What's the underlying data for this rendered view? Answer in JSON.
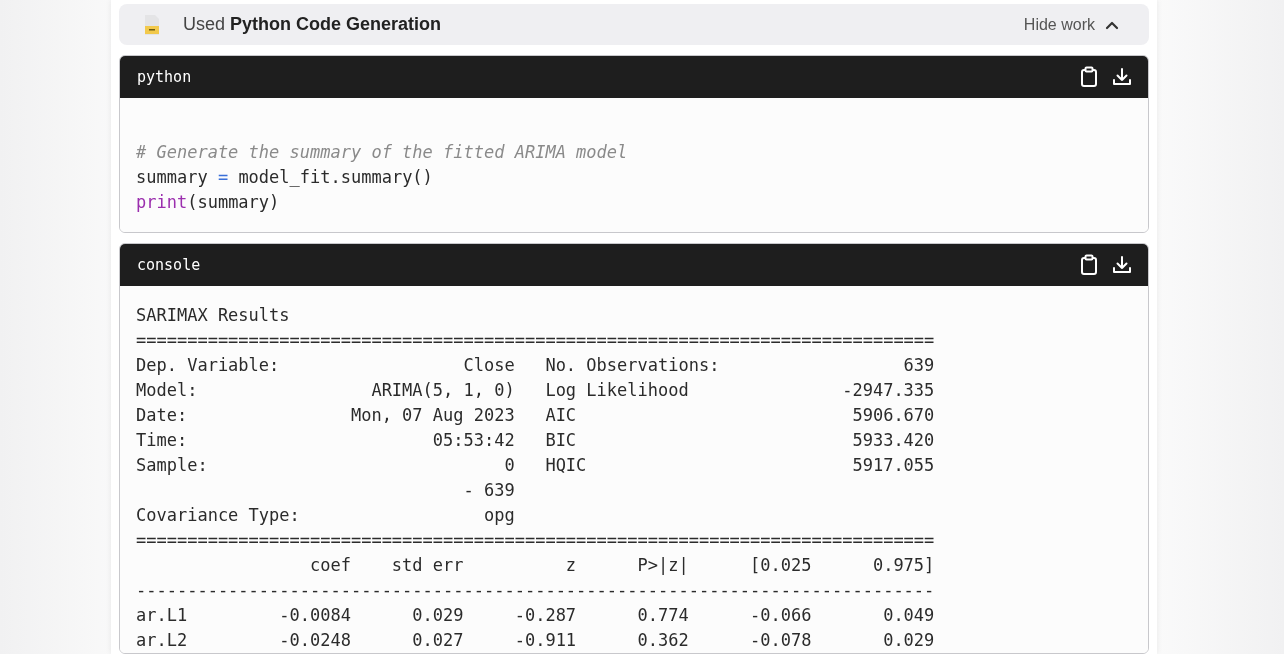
{
  "tool_bar": {
    "prefix": "Used",
    "tool_name": "Python Code Generation",
    "toggle_label": "Hide work",
    "expanded": true
  },
  "code_block": {
    "language": "python",
    "lines": [
      [
        {
          "kind": "comment",
          "text": "# Generate the summary of the fitted ARIMA model"
        }
      ],
      [
        {
          "kind": "plain",
          "text": "summary "
        },
        {
          "kind": "operator",
          "text": "="
        },
        {
          "kind": "plain",
          "text": " model_fit.summary()"
        }
      ],
      [
        {
          "kind": "builtin",
          "text": "print"
        },
        {
          "kind": "plain",
          "text": "(summary)"
        }
      ]
    ]
  },
  "console": {
    "title": "console",
    "lines": [
      "SARIMAX Results",
      "==============================================================================",
      "Dep. Variable:                  Close   No. Observations:                  639",
      "Model:                 ARIMA(5, 1, 0)   Log Likelihood               -2947.335",
      "Date:                Mon, 07 Aug 2023   AIC                           5906.670",
      "Time:                        05:53:42   BIC                           5933.420",
      "Sample:                             0   HQIC                          5917.055",
      "                                - 639",
      "Covariance Type:                  opg",
      "==============================================================================",
      "                 coef    std err          z      P>|z|      [0.025      0.975]",
      "------------------------------------------------------------------------------",
      "ar.L1         -0.0084      0.029     -0.287      0.774      -0.066       0.049",
      "ar.L2         -0.0248      0.027     -0.911      0.362      -0.078       0.029"
    ]
  }
}
